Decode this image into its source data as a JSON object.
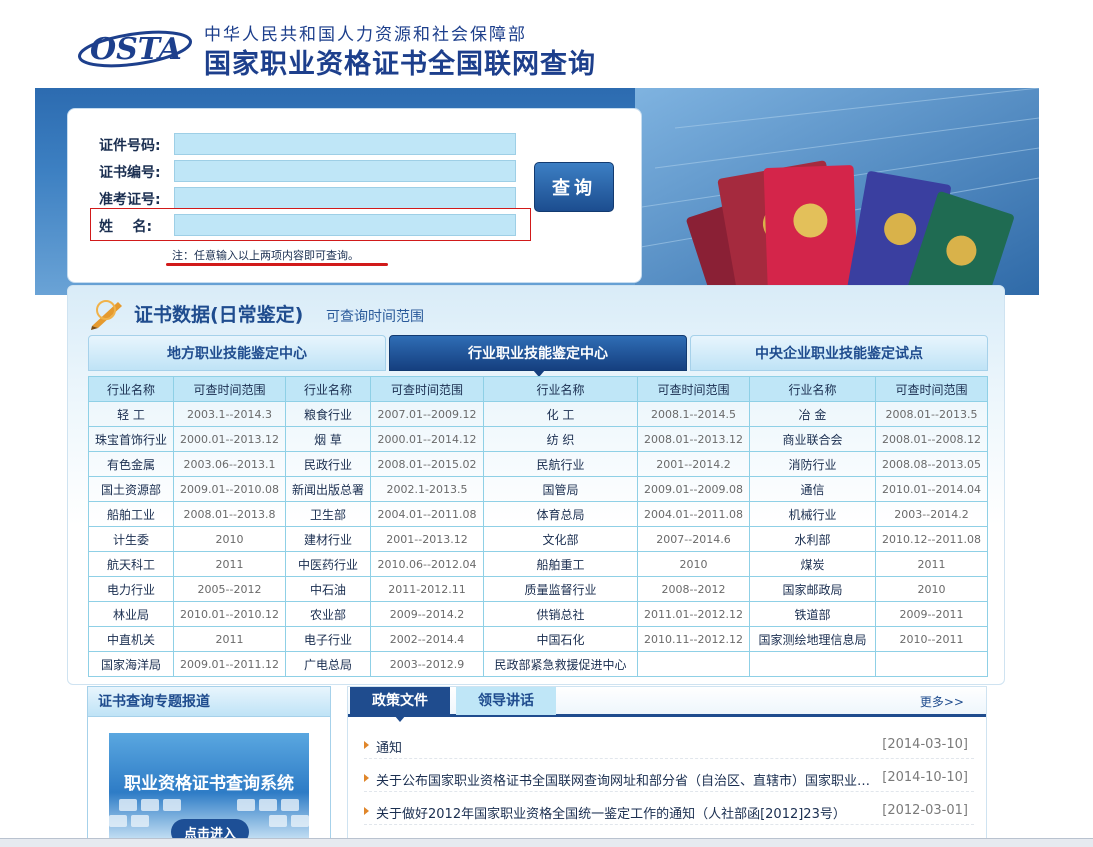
{
  "header": {
    "logo_text": "OSTA",
    "ministry": "中华人民共和国人力资源和社会保障部",
    "site_title": "国家职业资格证书全国联网查询"
  },
  "query": {
    "id_label": "证件号码:",
    "cert_label": "证书编号:",
    "exam_label": "准考证号:",
    "name_label": "姓    名:",
    "button_label": "查询",
    "note": "注：任意输入以上两项内容即可查询。"
  },
  "section": {
    "title": "证书数据(日常鉴定)",
    "subtitle": "可查询时间范围"
  },
  "tabs": [
    {
      "label": "地方职业技能鉴定中心",
      "active": false
    },
    {
      "label": "行业职业技能鉴定中心",
      "active": true
    },
    {
      "label": "中央企业职业技能鉴定试点",
      "active": false
    }
  ],
  "table": {
    "headers": [
      "行业名称",
      "可查时间范围",
      "行业名称",
      "可查时间范围",
      "行业名称",
      "可查时间范围",
      "行业名称",
      "可查时间范围"
    ],
    "rows": [
      [
        "轻  工",
        "2003.1--2014.3",
        "粮食行业",
        "2007.01--2009.12",
        "化  工",
        "2008.1--2014.5",
        "冶  金",
        "2008.01--2013.5"
      ],
      [
        "珠宝首饰行业",
        "2000.01--2013.12",
        "烟  草",
        "2000.01--2014.12",
        "纺  织",
        "2008.01--2013.12",
        "商业联合会",
        "2008.01--2008.12"
      ],
      [
        "有色金属",
        "2003.06--2013.1",
        "民政行业",
        "2008.01--2015.02",
        "民航行业",
        "2001--2014.2",
        "消防行业",
        "2008.08--2013.05"
      ],
      [
        "国土资源部",
        "2009.01--2010.08",
        "新闻出版总署",
        "2002.1-2013.5",
        "国管局",
        "2009.01--2009.08",
        "通信",
        "2010.01--2014.04"
      ],
      [
        "船舶工业",
        "2008.01--2013.8",
        "卫生部",
        "2004.01--2011.08",
        "体育总局",
        "2004.01--2011.08",
        "机械行业",
        "2003--2014.2"
      ],
      [
        "计生委",
        "2010",
        "建材行业",
        "2001--2013.12",
        "文化部",
        "2007--2014.6",
        "水利部",
        "2010.12--2011.08"
      ],
      [
        "航天科工",
        "2011",
        "中医药行业",
        "2010.06--2012.04",
        "船舶重工",
        "2010",
        "煤炭",
        "2011"
      ],
      [
        "电力行业",
        "2005--2012",
        "中石油",
        "2011-2012.11",
        "质量监督行业",
        "2008--2012",
        "国家邮政局",
        "2010"
      ],
      [
        "林业局",
        "2010.01--2010.12",
        "农业部",
        "2009--2014.2",
        "供销总社",
        "2011.01--2012.12",
        "铁道部",
        "2009--2011"
      ],
      [
        "中直机关",
        "2011",
        "电子行业",
        "2002--2014.4",
        "中国石化",
        "2010.11--2012.12",
        "国家测绘地理信息局",
        "2010--2011"
      ],
      [
        "国家海洋局",
        "2009.01--2011.12",
        "广电总局",
        "2003--2012.9",
        "民政部紧急救援促进中心",
        "",
        "",
        ""
      ]
    ]
  },
  "left_panel": {
    "title": "证书查询专题报道",
    "promo_title": "职业资格证书查询系统",
    "promo_button": "点击进入"
  },
  "news": {
    "tabs": [
      "政策文件",
      "领导讲话"
    ],
    "more": "更多>>",
    "items": [
      {
        "title": "通知",
        "date": "[2014-03-10]"
      },
      {
        "title": "关于公布国家职业资格证书全国联网查询网址和部分省（自治区、直辖市）国家职业资格证书查询网址的通知",
        "date": "[2014-10-10]"
      },
      {
        "title": "关于做好2012年国家职业资格全国统一鉴定工作的通知（人社部函[2012]23号）",
        "date": "[2012-03-01]"
      }
    ]
  },
  "colors": {
    "brand_blue": "#1d3f8c",
    "tab_active": "#153f7f",
    "table_header": "#bfe6f7",
    "highlight_red": "#d11a1a"
  }
}
